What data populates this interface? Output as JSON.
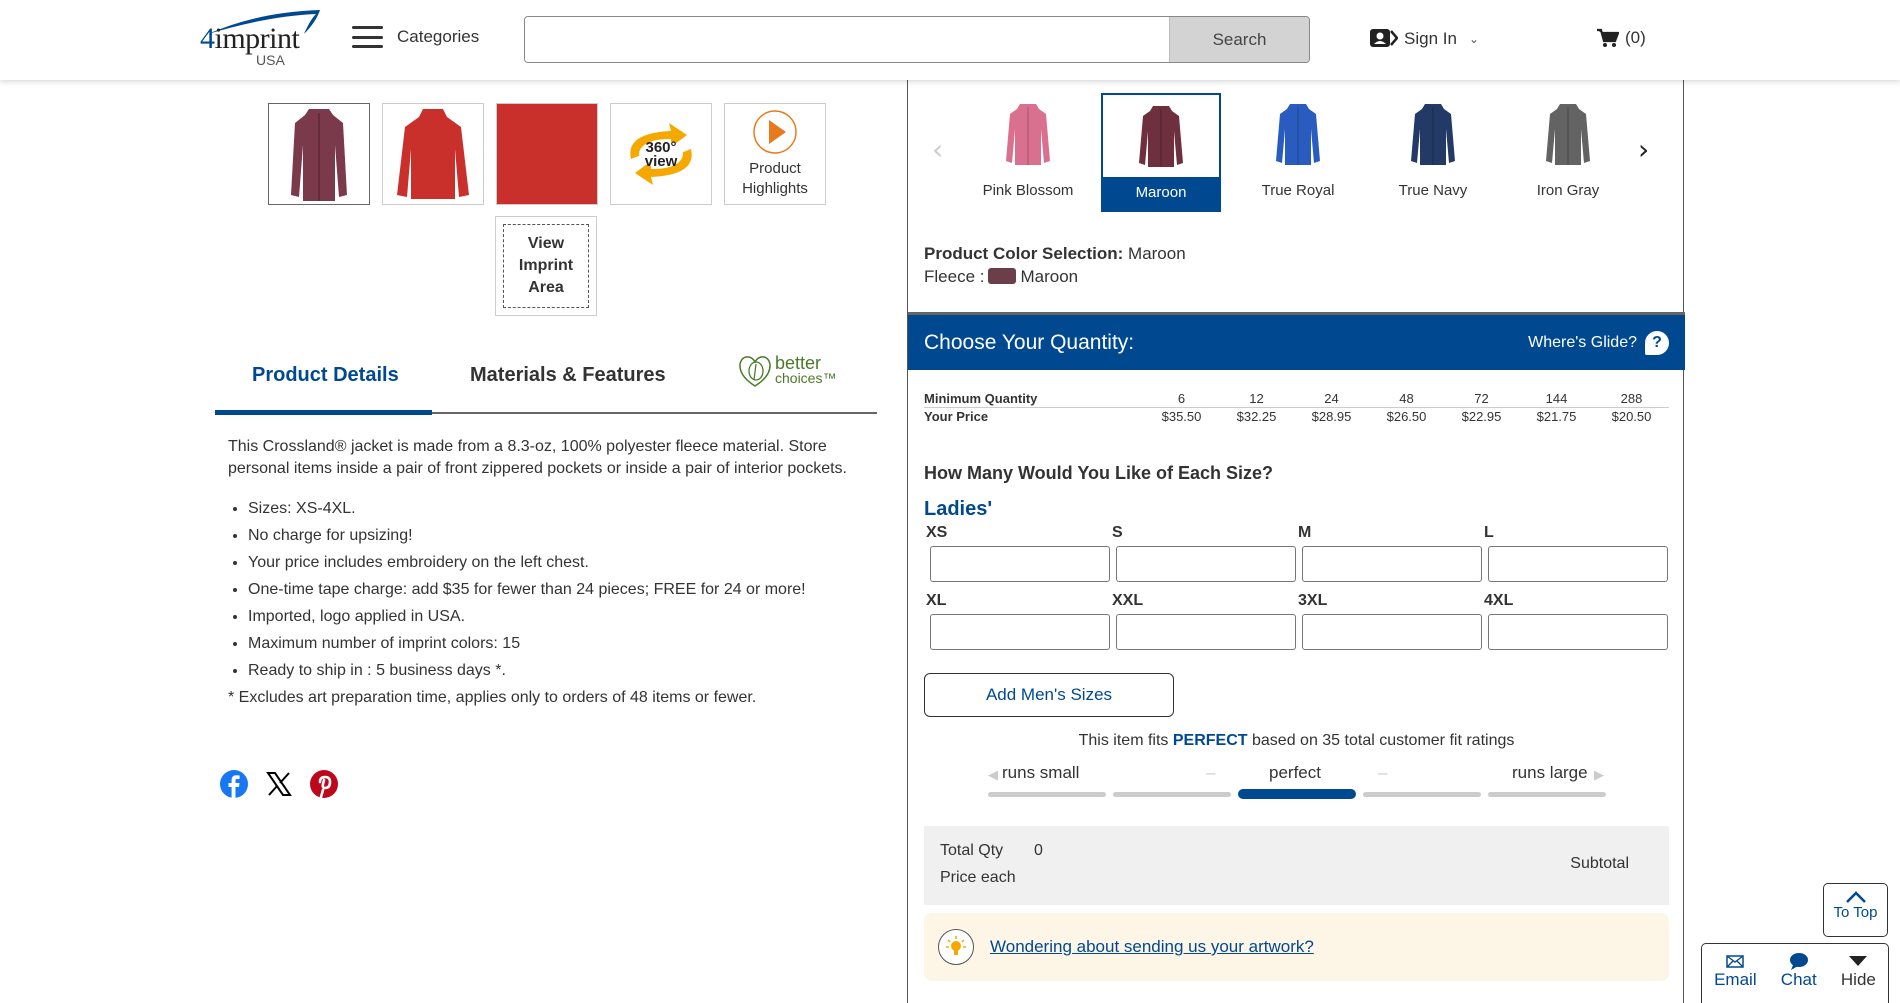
{
  "header": {
    "logo_brand": "imprint",
    "logo_number": "4",
    "logo_region": "USA",
    "menu_label": "Categories",
    "search_placeholder": "",
    "search_value": "",
    "search_button": "Search",
    "signin_label": "Sign In",
    "cart_count": "(0)"
  },
  "gallery": {
    "thumbnails": [
      {
        "name": "maroon-front",
        "color": "#7a3a4c",
        "active": true
      },
      {
        "name": "red-back",
        "color": "#c9302c",
        "active": false
      },
      {
        "name": "red-fabric",
        "color": "#c9302c",
        "active": false
      }
    ],
    "view360_line1": "360°",
    "view360_line2": "view",
    "highlights_line1": "Product",
    "highlights_line2": "Highlights",
    "imprint_line1": "View",
    "imprint_line2": "Imprint",
    "imprint_line3": "Area"
  },
  "tabs": {
    "details": "Product Details",
    "materials": "Materials & Features",
    "better_line1": "better",
    "better_line2": "choices™"
  },
  "description": {
    "intro": "This Crossland® jacket is made from a 8.3-oz, 100% polyester fleece material. Store personal items inside a pair of front zippered pockets or inside a pair of interior pockets.",
    "bullets": [
      "Sizes: XS-4XL.",
      "No charge for upsizing!",
      "Your price includes embroidery on the left chest.",
      "One-time tape charge: add $35 for fewer than 24 pieces; FREE for 24 or more!",
      "Imported, logo applied in USA.",
      "Maximum number of imprint colors: 15",
      "Ready to ship in : 5 business days *."
    ],
    "footnote": "* Excludes art preparation time, applies only to orders of 48 items or fewer."
  },
  "colors": {
    "swatches": [
      {
        "label": "Pink Blossom",
        "hex": "#d9708f"
      },
      {
        "label": "Maroon",
        "hex": "#6e2f3f",
        "selected": true
      },
      {
        "label": "True Royal",
        "hex": "#2a5cc0"
      },
      {
        "label": "True Navy",
        "hex": "#233a66"
      },
      {
        "label": "Iron Gray",
        "hex": "#636363"
      }
    ],
    "selection_label": "Product Color Selection:",
    "selection_value": "Maroon",
    "fleece_label": "Fleece :",
    "fleece_value": "Maroon",
    "fleece_hex": "#6b3e4a"
  },
  "quantity": {
    "title": "Choose Your Quantity:",
    "glide_label": "Where's Glide?",
    "min_qty_label": "Minimum Quantity",
    "price_label": "Your Price",
    "tiers": [
      {
        "qty": "6",
        "price": "$35.50"
      },
      {
        "qty": "12",
        "price": "$32.25"
      },
      {
        "qty": "24",
        "price": "$28.95"
      },
      {
        "qty": "48",
        "price": "$26.50"
      },
      {
        "qty": "72",
        "price": "$22.95"
      },
      {
        "qty": "144",
        "price": "$21.75"
      },
      {
        "qty": "288",
        "price": "$20.50"
      }
    ],
    "size_question": "How Many Would You Like of Each Size?",
    "group_label": "Ladies'",
    "sizes": [
      {
        "label": "XS",
        "value": ""
      },
      {
        "label": "S",
        "value": ""
      },
      {
        "label": "M",
        "value": ""
      },
      {
        "label": "L",
        "value": ""
      },
      {
        "label": "XL",
        "value": ""
      },
      {
        "label": "XXL",
        "value": ""
      },
      {
        "label": "3XL",
        "value": ""
      },
      {
        "label": "4XL",
        "value": ""
      }
    ],
    "add_mens_label": "Add Men's Sizes"
  },
  "fit": {
    "prefix": "This item fits",
    "rating": "PERFECT",
    "suffix": "based on 35 total customer fit ratings",
    "label_small": "runs small",
    "label_perfect": "perfect",
    "label_large": "runs large",
    "dash": "–",
    "selected_index": 2,
    "segments": 5
  },
  "totals": {
    "total_qty_label": "Total Qty",
    "total_qty_value": "0",
    "price_each_label": "Price each",
    "subtotal_label": "Subtotal"
  },
  "artwork_link": "Wondering about sending us your artwork?",
  "floating": {
    "to_top": "To Top",
    "email": "Email",
    "chat": "Chat",
    "hide": "Hide"
  },
  "theme": {
    "brand_blue": "#004990",
    "fit_inactive": "#cccccc"
  }
}
